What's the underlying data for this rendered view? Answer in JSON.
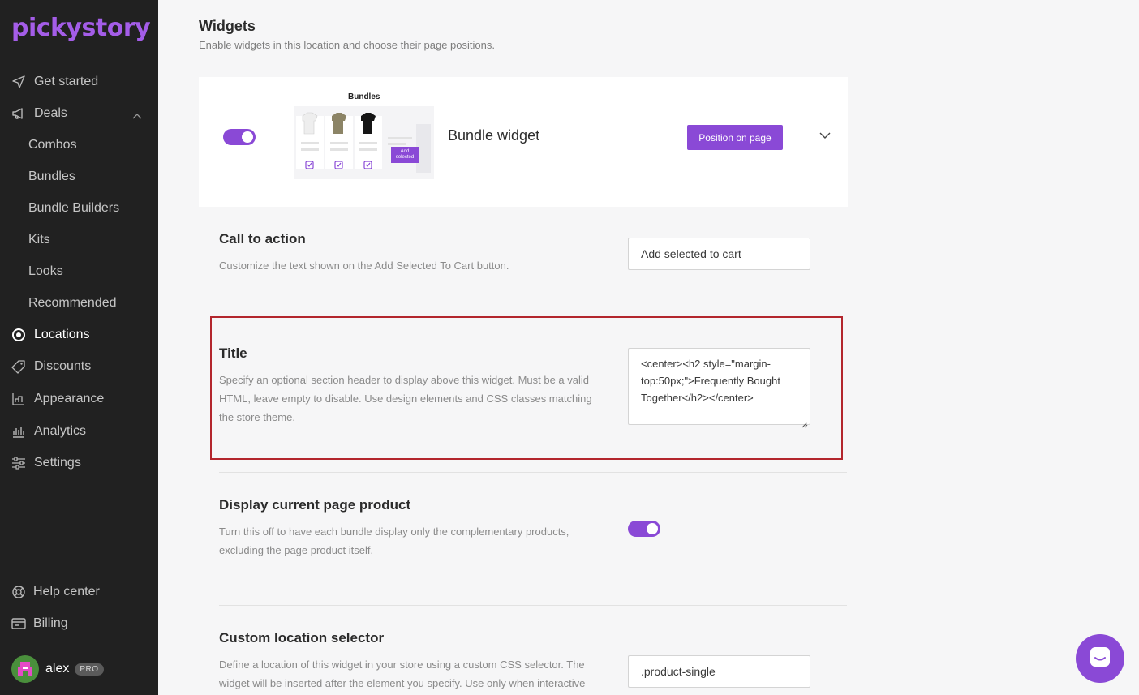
{
  "brand": {
    "logo_text": "pickystory",
    "accent": "#8a49d6"
  },
  "sidebar": {
    "items": [
      {
        "label": "Get started",
        "icon": "send-icon"
      },
      {
        "label": "Deals",
        "icon": "megaphone-icon"
      },
      {
        "label": "Combos"
      },
      {
        "label": "Bundles"
      },
      {
        "label": "Bundle Builders"
      },
      {
        "label": "Kits"
      },
      {
        "label": "Looks"
      },
      {
        "label": "Recommended"
      },
      {
        "label": "Locations",
        "icon": "target-icon"
      },
      {
        "label": "Discounts",
        "icon": "tag-icon"
      },
      {
        "label": "Appearance",
        "icon": "appearance-icon"
      },
      {
        "label": "Analytics",
        "icon": "bar-chart-icon"
      },
      {
        "label": "Settings",
        "icon": "sliders-icon"
      }
    ],
    "bottom": [
      {
        "label": "Help center",
        "icon": "lifebuoy-icon"
      },
      {
        "label": "Billing",
        "icon": "credit-card-icon"
      }
    ],
    "user": {
      "name": "alex",
      "badge": "PRO"
    }
  },
  "widgets": {
    "heading": "Widgets",
    "subheading": "Enable widgets in this location and choose their page positions.",
    "bundle": {
      "name": "Bundle widget",
      "enabled": true,
      "position_button": "Position on page",
      "preview_title": "Bundles",
      "preview_button": "Add selected"
    }
  },
  "settings": {
    "cta": {
      "title": "Call to action",
      "desc": "Customize the text shown on the Add Selected To Cart button.",
      "value": "Add selected to cart"
    },
    "title_field": {
      "title": "Title",
      "desc": "Specify an optional section header to display above this widget. Must be a valid HTML, leave empty to disable. Use design elements and CSS classes matching the store theme.",
      "value": "<center><h2 style=\"margin-top:50px;\">Frequently Bought Together</h2></center>"
    },
    "display_product": {
      "title": "Display current page product",
      "desc": "Turn this off to have each bundle display only the complementary products, excluding the page product itself.",
      "enabled": true
    },
    "custom_selector": {
      "title": "Custom location selector",
      "desc": "Define a location of this widget in your store using a custom CSS selector. The widget will be inserted after the element you specify. Use only when interactive",
      "value": ".product-single"
    }
  }
}
